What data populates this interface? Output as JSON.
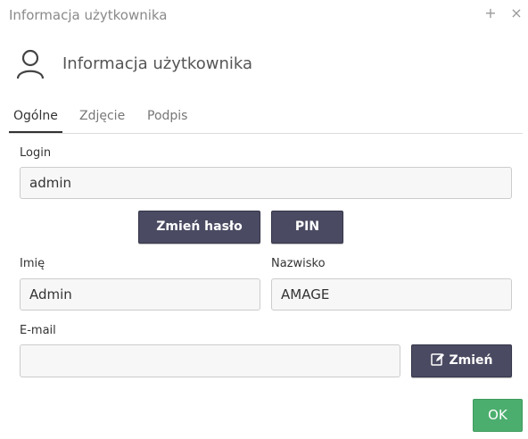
{
  "window": {
    "title": "Informacja użytkownika",
    "maximize_glyph": "+",
    "close_glyph": "×"
  },
  "header": {
    "icon": "user-icon",
    "title": "Informacja użytkownika"
  },
  "tabs": [
    {
      "label": "Ogólne",
      "active": true
    },
    {
      "label": "Zdjęcie",
      "active": false
    },
    {
      "label": "Podpis",
      "active": false
    }
  ],
  "form": {
    "login_label": "Login",
    "login_value": "admin",
    "change_password_label": "Zmień hasło",
    "pin_label": "PIN",
    "first_name_label": "Imię",
    "first_name_value": "Admin",
    "last_name_label": "Nazwisko",
    "last_name_value": "AMAGE",
    "email_label": "E-mail",
    "email_value": "",
    "change_email_label": "Zmień",
    "change_email_icon": "edit-icon"
  },
  "footer": {
    "ok_label": "OK"
  },
  "colors": {
    "dark_button": "#4a4a62",
    "ok_button": "#4cae6e",
    "input_bg": "#f7f7f7"
  }
}
